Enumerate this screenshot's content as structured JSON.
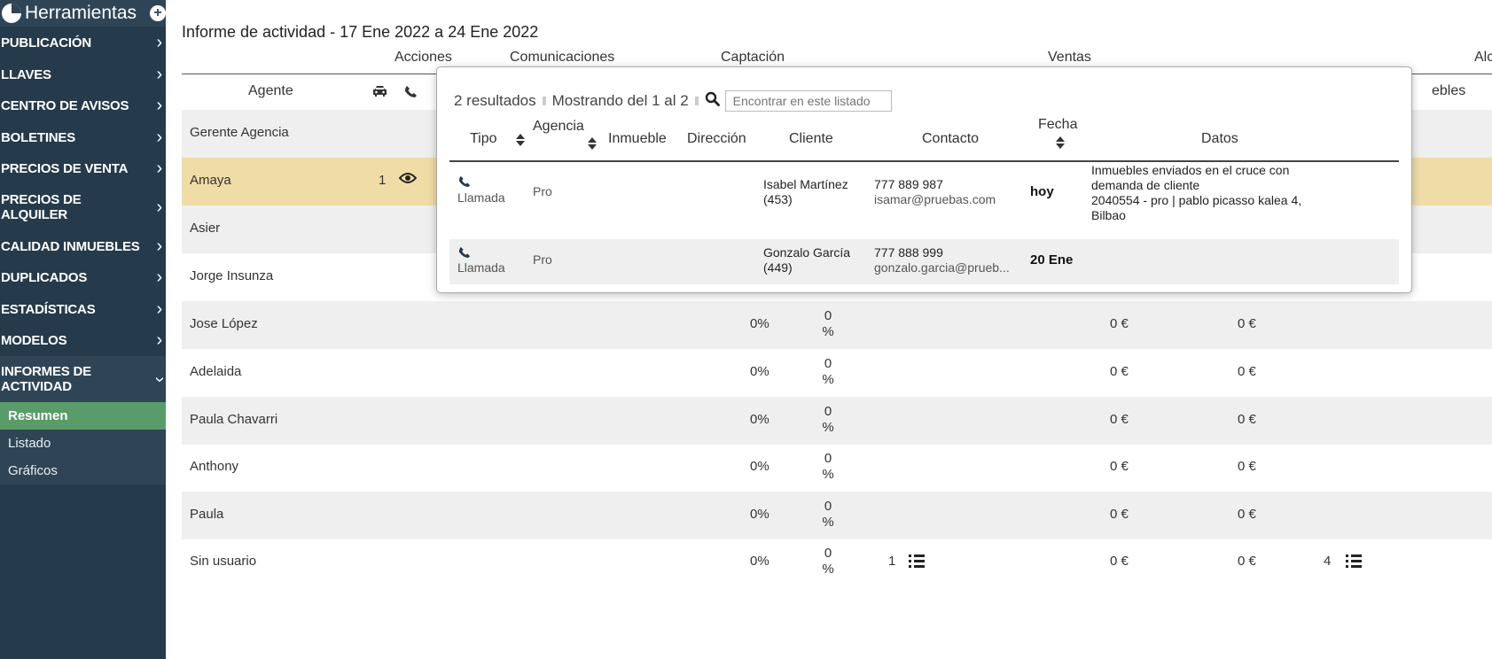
{
  "sidebar": {
    "title": "Herramientas",
    "items": [
      {
        "label": "PUBLICACIÓN"
      },
      {
        "label": "LLAVES"
      },
      {
        "label": "CENTRO DE AVISOS"
      },
      {
        "label": "BOLETINES"
      },
      {
        "label": "PRECIOS DE VENTA"
      },
      {
        "label": "PRECIOS DE ALQUILER"
      },
      {
        "label": "CALIDAD INMUEBLES"
      },
      {
        "label": "DUPLICADOS"
      },
      {
        "label": "ESTADÍSTICAS"
      },
      {
        "label": "MODELOS"
      },
      {
        "label": "INFORMES DE ACTIVIDAD"
      }
    ],
    "subitems": [
      {
        "label": "Resumen"
      },
      {
        "label": "Listado"
      },
      {
        "label": "Gráficos"
      }
    ]
  },
  "report": {
    "title": "Informe de actividad - 17 Ene 2022 a 24 Ene 2022",
    "groups": {
      "acciones": "Acciones",
      "comunicaciones": "Comunicaciones",
      "captacion": "Captación",
      "ventas": "Ventas",
      "alc": "Alc"
    },
    "headers": {
      "agente": "Agente",
      "inmuebles_partial": "ebles"
    },
    "rows": [
      {
        "name": "Gerente Agencia"
      },
      {
        "name": "Amaya",
        "count": "1"
      },
      {
        "name": "Asier"
      },
      {
        "name": "Jorge Insunza"
      },
      {
        "name": "Jose López",
        "pct": "0%",
        "pct2_num": "0",
        "pct2_sym": "%",
        "eur1": "0 €",
        "eur2": "0 €"
      },
      {
        "name": "Adelaida",
        "pct": "0%",
        "pct2_num": "0",
        "pct2_sym": "%",
        "eur1": "0 €",
        "eur2": "0 €"
      },
      {
        "name": "Paula Chavarri",
        "pct": "0%",
        "pct2_num": "0",
        "pct2_sym": "%",
        "eur1": "0 €",
        "eur2": "0 €"
      },
      {
        "name": "Anthony",
        "pct": "0%",
        "pct2_num": "0",
        "pct2_sym": "%",
        "eur1": "0 €",
        "eur2": "0 €"
      },
      {
        "name": "Paula",
        "pct": "0%",
        "pct2_num": "0",
        "pct2_sym": "%",
        "eur1": "0 €",
        "eur2": "0 €"
      },
      {
        "name": "Sin usuario",
        "pct": "0%",
        "pct2_num": "0",
        "pct2_sym": "%",
        "count_a": "1",
        "eur1": "0 €",
        "eur2": "0 €",
        "count_b": "4"
      }
    ]
  },
  "popup": {
    "results": "2 resultados",
    "showing": "Mostrando del 1 al 2",
    "search_placeholder": "Encontrar en este listado",
    "columns": {
      "tipo": "Tipo",
      "agencia": "Agencia",
      "inmueble": "Inmueble",
      "direccion": "Dirección",
      "cliente": "Cliente",
      "contacto": "Contacto",
      "fecha": "Fecha",
      "datos": "Datos"
    },
    "rows": [
      {
        "tipo": "Llamada",
        "agencia": "Pro",
        "cliente_1": "Isabel Martínez",
        "cliente_2": "(453)",
        "telefono": "777 889 987",
        "email": "isamar@pruebas.com",
        "fecha": "hoy",
        "datos_1": "Inmuebles enviados en el cruce con",
        "datos_2": "demanda de cliente",
        "datos_3": "2040554 - pro | pablo picasso kalea 4,",
        "datos_4": "Bilbao"
      },
      {
        "tipo": "Llamada",
        "agencia": "Pro",
        "cliente_1": "Gonzalo García",
        "cliente_2": "(449)",
        "telefono": "777 888 999",
        "email": "gonzalo.garcia@prueb...",
        "fecha": "20 Ene"
      }
    ]
  },
  "colors": {
    "sidebar_bg": "#253a4a",
    "active_sub": "#5a9b6a",
    "highlight_row": "#f0dca6",
    "alt_row": "#efefef"
  }
}
